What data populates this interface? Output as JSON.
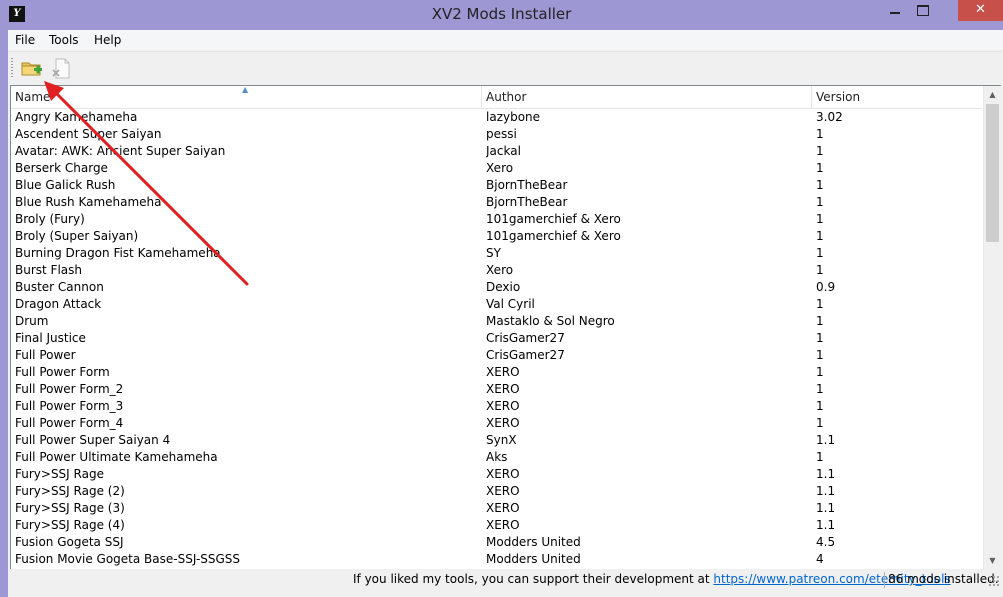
{
  "window": {
    "title": "XV2 Mods Installer",
    "icon": "xv2-app-icon",
    "minimize_symbol": "",
    "close_symbol": "✕"
  },
  "menu": {
    "file": "File",
    "tools": "Tools",
    "help": "Help"
  },
  "toolbar": {
    "add_icon": "folder-add-icon",
    "remove_icon": "document-remove-icon"
  },
  "columns": {
    "name": "Name",
    "author": "Author",
    "version": "Version"
  },
  "mods": [
    {
      "name": "Angry Kamehameha",
      "author": "lazybone",
      "version": "3.02"
    },
    {
      "name": "Ascendent Super Saiyan",
      "author": "pessi",
      "version": "1"
    },
    {
      "name": "Avatar: AWK: Ancient Super Saiyan",
      "author": "Jackal",
      "version": "1"
    },
    {
      "name": "Berserk Charge",
      "author": "Xero",
      "version": "1"
    },
    {
      "name": "Blue Galick Rush",
      "author": "BjornTheBear",
      "version": "1"
    },
    {
      "name": "Blue Rush Kamehameha",
      "author": "BjornTheBear",
      "version": "1"
    },
    {
      "name": "Broly (Fury)",
      "author": "101gamerchief & Xero",
      "version": "1"
    },
    {
      "name": "Broly (Super Saiyan)",
      "author": "101gamerchief & Xero",
      "version": "1"
    },
    {
      "name": "Burning Dragon Fist Kamehameha",
      "author": "SY",
      "version": "1"
    },
    {
      "name": "Burst Flash",
      "author": "Xero",
      "version": "1"
    },
    {
      "name": "Buster Cannon",
      "author": "Dexio",
      "version": "0.9"
    },
    {
      "name": "Dragon Attack",
      "author": "Val Cyril",
      "version": "1"
    },
    {
      "name": "Drum",
      "author": "Mastaklo & Sol Negro",
      "version": "1"
    },
    {
      "name": "Final Justice",
      "author": "CrisGamer27",
      "version": "1"
    },
    {
      "name": "Full Power",
      "author": "CrisGamer27",
      "version": "1"
    },
    {
      "name": "Full Power Form",
      "author": "XERO",
      "version": "1"
    },
    {
      "name": "Full Power Form_2",
      "author": "XERO",
      "version": "1"
    },
    {
      "name": "Full Power Form_3",
      "author": "XERO",
      "version": "1"
    },
    {
      "name": "Full Power Form_4",
      "author": "XERO",
      "version": "1"
    },
    {
      "name": "Full Power Super Saiyan 4",
      "author": "SynX",
      "version": "1.1"
    },
    {
      "name": "Full Power Ultimate Kamehameha",
      "author": "Aks",
      "version": "1"
    },
    {
      "name": "Fury>SSJ Rage",
      "author": "XERO",
      "version": "1.1"
    },
    {
      "name": "Fury>SSJ Rage (2)",
      "author": "XERO",
      "version": "1.1"
    },
    {
      "name": "Fury>SSJ Rage (3)",
      "author": "XERO",
      "version": "1.1"
    },
    {
      "name": "Fury>SSJ Rage (4)",
      "author": "XERO",
      "version": "1.1"
    },
    {
      "name": "Fusion Gogeta SSJ",
      "author": "Modders United",
      "version": "4.5"
    },
    {
      "name": "Fusion Movie Gogeta Base-SSJ-SSGSS",
      "author": "Modders United",
      "version": "4"
    }
  ],
  "status": {
    "message": "If you liked my tools, you can support their development at ",
    "link": "https://www.patreon.com/eternity_tools",
    "count": "86 mods installed."
  },
  "colors": {
    "title_bar": "#9d97d3",
    "close_button": "#c7504b",
    "annotation_arrow": "#e02020",
    "link": "#0066cc"
  }
}
